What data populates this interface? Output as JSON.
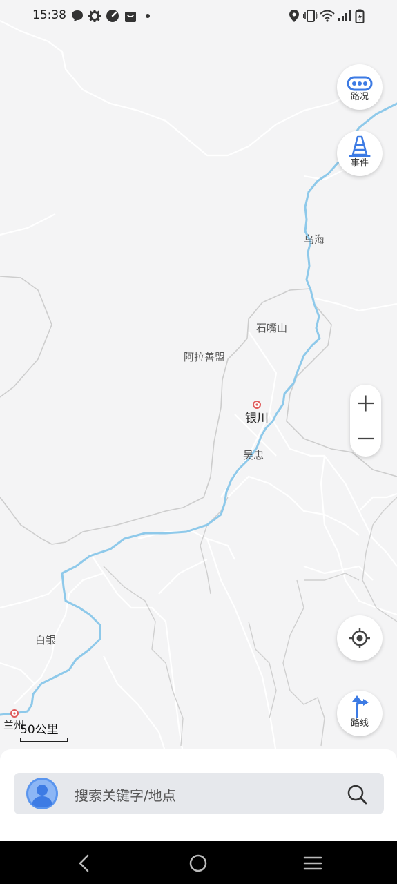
{
  "status_bar": {
    "time": "15:38",
    "left_icons": [
      "chat-bubble-icon",
      "gear-icon",
      "gauge-icon",
      "shopping-bag-icon",
      "dot-icon"
    ],
    "right_icons": [
      "location-pin-icon",
      "vibrate-icon",
      "wifi-icon",
      "signal-icon",
      "battery-charging-icon"
    ]
  },
  "map": {
    "places": [
      {
        "name": "乌海",
        "major": false
      },
      {
        "name": "石嘴山",
        "major": false
      },
      {
        "name": "阿拉善盟",
        "major": false
      },
      {
        "name": "银川",
        "major": true
      },
      {
        "name": "吴忠",
        "major": false
      },
      {
        "name": "白银",
        "major": false
      },
      {
        "name": "兰州",
        "major": false
      }
    ],
    "scale_label": "50公里",
    "colors": {
      "background": "#f4f4f5",
      "river": "#8ec9ea",
      "border": "#c8c8c8",
      "road": "#ffffff",
      "city_dot": "#e05b5b"
    }
  },
  "controls": {
    "traffic_label": "路况",
    "events_label": "事件",
    "route_label": "路线",
    "zoom_in": "+",
    "zoom_out": "−",
    "accent": "#3d7be4"
  },
  "search": {
    "placeholder": "搜索关键字/地点"
  },
  "nav_bar": {
    "buttons": [
      "back-icon",
      "home-icon",
      "menu-icon"
    ]
  }
}
